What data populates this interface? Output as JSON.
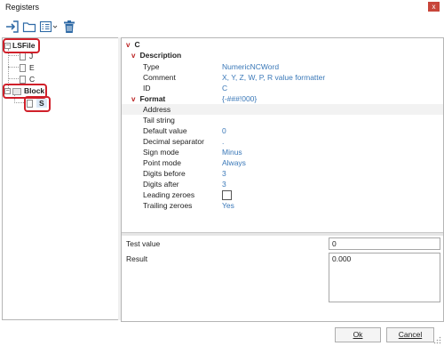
{
  "window": {
    "title": "Registers",
    "close_label": "x"
  },
  "toolbar": {
    "icons": [
      "import-icon",
      "folder-icon",
      "list-dropdown-icon",
      "delete-icon"
    ]
  },
  "tree": {
    "root": {
      "label": "LSFile"
    },
    "items": [
      {
        "label": "J"
      },
      {
        "label": "E"
      },
      {
        "label": "C"
      }
    ],
    "block": {
      "label": "Block",
      "children": [
        {
          "label": "S"
        }
      ]
    }
  },
  "properties": {
    "section": "C",
    "description": {
      "header": "Description",
      "rows": [
        {
          "name": "Type",
          "value": "NumericNCWord"
        },
        {
          "name": "Comment",
          "value": "X, Y, Z, W, P, R value formatter"
        },
        {
          "name": "ID",
          "value": "C"
        }
      ]
    },
    "format": {
      "header": "Format",
      "value": "{-###!000}",
      "rows": [
        {
          "name": "Address",
          "value": ""
        },
        {
          "name": "Tail string",
          "value": ""
        },
        {
          "name": "Default value",
          "value": "0"
        },
        {
          "name": "Decimal separator",
          "value": "."
        },
        {
          "name": "Sign mode",
          "value": "Minus"
        },
        {
          "name": "Point mode",
          "value": "Always"
        },
        {
          "name": "Digits before",
          "value": "3"
        },
        {
          "name": "Digits after",
          "value": "3"
        },
        {
          "name": "Leading zeroes",
          "value": ""
        },
        {
          "name": "Trailing zeroes",
          "value": "Yes"
        }
      ],
      "leading_zeroes_checked": false
    }
  },
  "test": {
    "test_label": "Test value",
    "test_value": "0",
    "result_label": "Result",
    "result_value": "0.000"
  },
  "buttons": {
    "ok": "Ok",
    "cancel": "Cancel"
  }
}
